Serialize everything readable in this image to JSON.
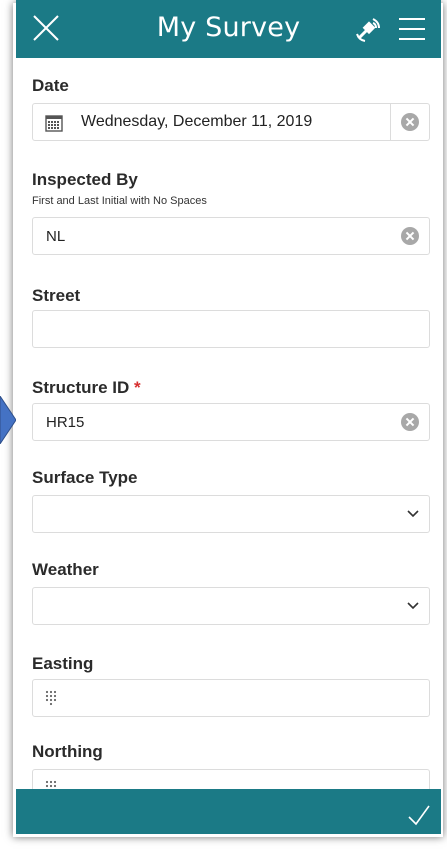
{
  "header": {
    "title": "My Survey"
  },
  "fields": {
    "date": {
      "label": "Date",
      "value": "Wednesday, December 11, 2019"
    },
    "inspected_by": {
      "label": "Inspected By",
      "hint": "First and Last Initial with No Spaces",
      "value": "NL"
    },
    "street": {
      "label": "Street",
      "value": ""
    },
    "structure_id": {
      "label": "Structure ID",
      "required_mark": "*",
      "value": "HR15"
    },
    "surface_type": {
      "label": "Surface Type",
      "value": ""
    },
    "weather": {
      "label": "Weather",
      "value": ""
    },
    "easting": {
      "label": "Easting",
      "value": ""
    },
    "northing": {
      "label": "Northing",
      "value": ""
    }
  },
  "icons": {
    "close": "close-icon",
    "gps": "gps-signal-icon",
    "menu": "hamburger-menu-icon",
    "calendar": "calendar-icon",
    "clear": "clear-circle-icon",
    "dropdown": "chevron-down-icon",
    "keypad": "keypad-icon",
    "submit": "checkmark-icon"
  },
  "colors": {
    "header_bg": "#1b7a86",
    "required": "#d72f2f",
    "pointer_arrow": "#4472c4"
  }
}
